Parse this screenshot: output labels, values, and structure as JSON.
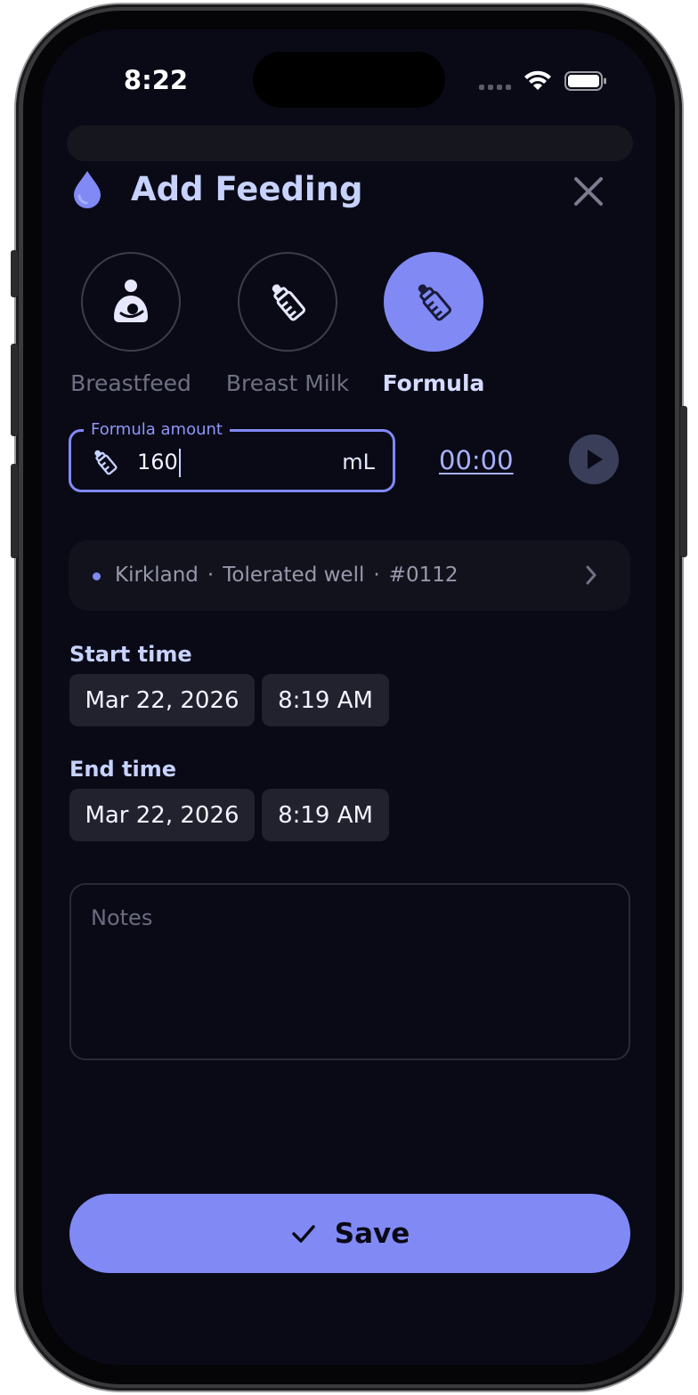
{
  "status_bar": {
    "time": "8:22"
  },
  "header": {
    "title": "Add Feeding"
  },
  "feeding_types": [
    {
      "label": "Breastfeed",
      "icon": "breastfeed-icon",
      "selected": false
    },
    {
      "label": "Breast Milk",
      "icon": "baby-bottle-icon",
      "selected": false
    },
    {
      "label": "Formula",
      "icon": "baby-bottle-icon",
      "selected": true
    }
  ],
  "amount": {
    "legend": "Formula amount",
    "value": "160",
    "unit": "mL"
  },
  "timer": {
    "value": "00:00"
  },
  "product": {
    "brand": "Kirkland",
    "note": "Tolerated well",
    "code": "#0112",
    "separator": "·"
  },
  "start_time": {
    "label": "Start time",
    "date": "Mar 22, 2026",
    "time": "8:19 AM"
  },
  "end_time": {
    "label": "End time",
    "date": "Mar 22, 2026",
    "time": "8:19 AM"
  },
  "notes": {
    "placeholder": "Notes"
  },
  "actions": {
    "save_label": "Save"
  },
  "colors": {
    "accent": "#8189f5",
    "background": "#0a0a17",
    "title": "#c7d2fe"
  }
}
